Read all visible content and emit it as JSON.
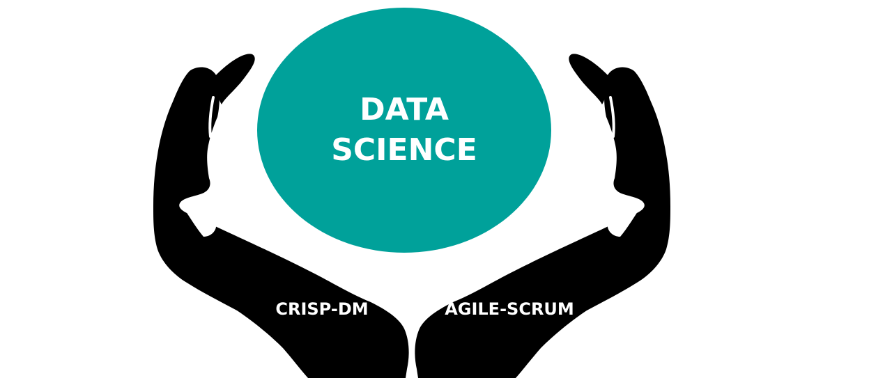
{
  "center": {
    "line1": "DATA",
    "line2": "SCIENCE"
  },
  "left_hand": {
    "label": "CRISP-DM"
  },
  "right_hand": {
    "label": "AGILE-SCRUM"
  },
  "colors": {
    "circle": "#00A19A",
    "hands": "#000000",
    "text": "#FFFFFF",
    "background": "#FFFFFF"
  },
  "icons": {
    "left": "cupped-left-hand-icon",
    "right": "cupped-right-hand-icon"
  }
}
